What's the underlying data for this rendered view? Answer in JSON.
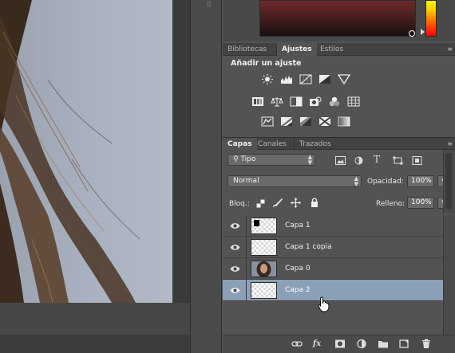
{
  "panels": {
    "adjust_tabs": [
      "Bibliotecas",
      "Ajustes",
      "Estilos"
    ],
    "adjust_active_tab": "Ajustes",
    "adjust_title": "Añadir un ajuste",
    "adjust_icons": [
      [
        "brightness-contrast-icon",
        "levels-icon",
        "curves-icon",
        "exposure-icon",
        "vibrance-icon"
      ],
      [
        "hue-saturation-icon",
        "color-balance-icon",
        "black-white-icon",
        "photo-filter-icon",
        "channel-mixer-icon",
        "color-lookup-icon"
      ],
      [
        "invert-icon",
        "posterize-icon",
        "threshold-icon",
        "selective-color-icon",
        "gradient-map-icon"
      ]
    ],
    "layers_tabs": [
      "Capas",
      "Canales",
      "Trazados"
    ],
    "layers_active_tab": "Capas"
  },
  "layers_panel": {
    "filter_kind": "Tipo",
    "blend_mode": "Normal",
    "opacity_label": "Opacidad:",
    "opacity_value": "100%",
    "lock_label": "Bloq.:",
    "fill_label": "Relleno:",
    "fill_value": "100%",
    "layers": [
      {
        "name": "Capa 1",
        "selected": false,
        "thumb": "mask"
      },
      {
        "name": "Capa 1 copia",
        "selected": false,
        "thumb": "transparent"
      },
      {
        "name": "Capa 0",
        "selected": false,
        "thumb": "photo"
      },
      {
        "name": "Capa 2",
        "selected": true,
        "thumb": "transparent"
      }
    ],
    "footer_icons": [
      "link-layers-icon",
      "fx-icon",
      "add-mask-icon",
      "adjustment-layer-icon",
      "new-group-icon",
      "new-layer-icon",
      "delete-layer-icon"
    ],
    "footer_fx_label": "fx"
  },
  "colors": {
    "selected_row": "#8b9fb7",
    "panel_bg": "#535353",
    "canvas_sky": "#a9b0bf"
  }
}
